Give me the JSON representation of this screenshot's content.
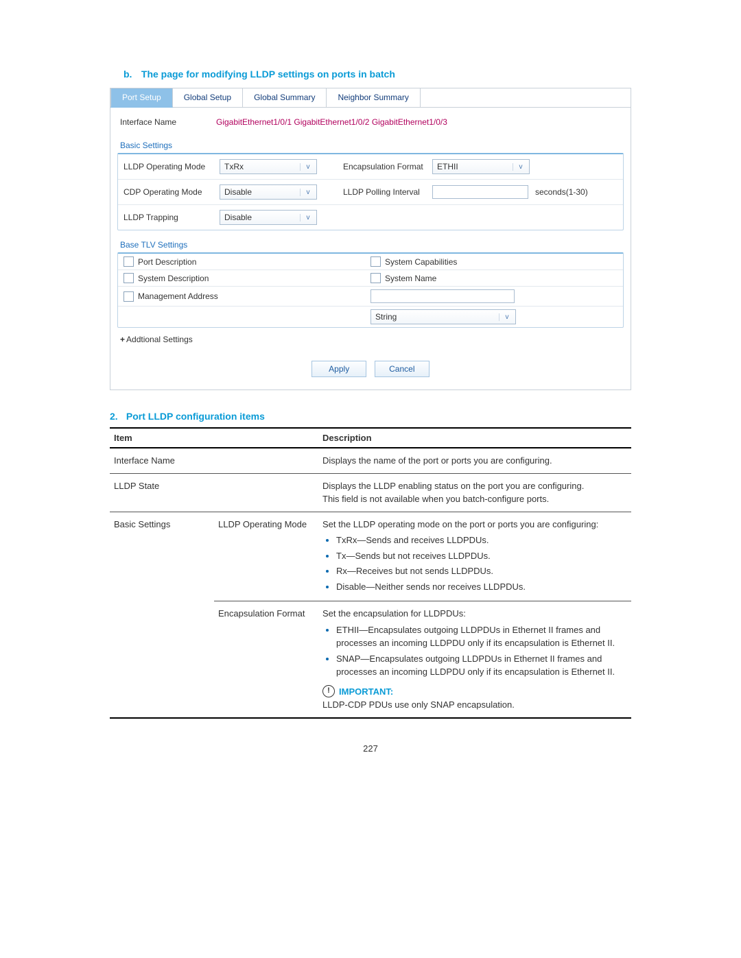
{
  "section_b": {
    "num": "b.",
    "title": "The page for modifying LLDP settings on ports in batch"
  },
  "tabs": [
    "Port Setup",
    "Global Setup",
    "Global Summary",
    "Neighbor Summary"
  ],
  "interface_name_label": "Interface Name",
  "interface_names": "GigabitEthernet1/0/1 GigabitEthernet1/0/2 GigabitEthernet1/0/3",
  "basic_group": "Basic Settings",
  "rows": {
    "lldp_mode_label": "LLDP Operating Mode",
    "lldp_mode_value": "TxRx",
    "encap_label": "Encapsulation Format",
    "encap_value": "ETHII",
    "cdp_mode_label": "CDP Operating Mode",
    "cdp_mode_value": "Disable",
    "poll_label": "LLDP Polling Interval",
    "poll_value": "",
    "poll_suffix": "seconds(1-30)",
    "trap_label": "LLDP Trapping",
    "trap_value": "Disable"
  },
  "tlv_group": "Base TLV Settings",
  "tlv": {
    "port_desc": "Port Description",
    "sys_cap": "System Capabilities",
    "sys_desc": "System Description",
    "sys_name": "System Name",
    "mgmt_addr": "Management Address",
    "string_value": "String"
  },
  "additional": "Addtional Settings",
  "buttons": {
    "apply": "Apply",
    "cancel": "Cancel"
  },
  "section_2": {
    "num": "2.",
    "title": "Port LLDP configuration items"
  },
  "table": {
    "head_item": "Item",
    "head_desc": "Description",
    "r1_item": "Interface Name",
    "r1_desc": "Displays the name of the port or ports you are configuring.",
    "r2_item": "LLDP State",
    "r2_desc_a": "Displays the LLDP enabling status on the port you are configuring.",
    "r2_desc_b": "This field is not available when you batch-configure ports.",
    "r3_group": "Basic Settings",
    "r3a_sub": "LLDP Operating Mode",
    "r3a_lead": "Set the LLDP operating mode on the port or ports you are configuring:",
    "r3a_b1": "TxRx—Sends and receives LLDPDUs.",
    "r3a_b2": "Tx—Sends but not receives LLDPDUs.",
    "r3a_b3": "Rx—Receives but not sends LLDPDUs.",
    "r3a_b4": "Disable—Neither sends nor receives LLDPDUs.",
    "r3b_sub": "Encapsulation Format",
    "r3b_lead": "Set the encapsulation for LLDPDUs:",
    "r3b_b1": "ETHII—Encapsulates outgoing LLDPDUs in Ethernet II frames and processes an incoming LLDPDU only if its encapsulation is Ethernet II.",
    "r3b_b2": "SNAP—Encapsulates outgoing LLDPDUs in Ethernet II frames and processes an incoming LLDPDU only if its encapsulation is Ethernet II.",
    "r3b_important": "IMPORTANT:",
    "r3b_note": "LLDP-CDP PDUs use only SNAP encapsulation."
  },
  "page_number": "227"
}
